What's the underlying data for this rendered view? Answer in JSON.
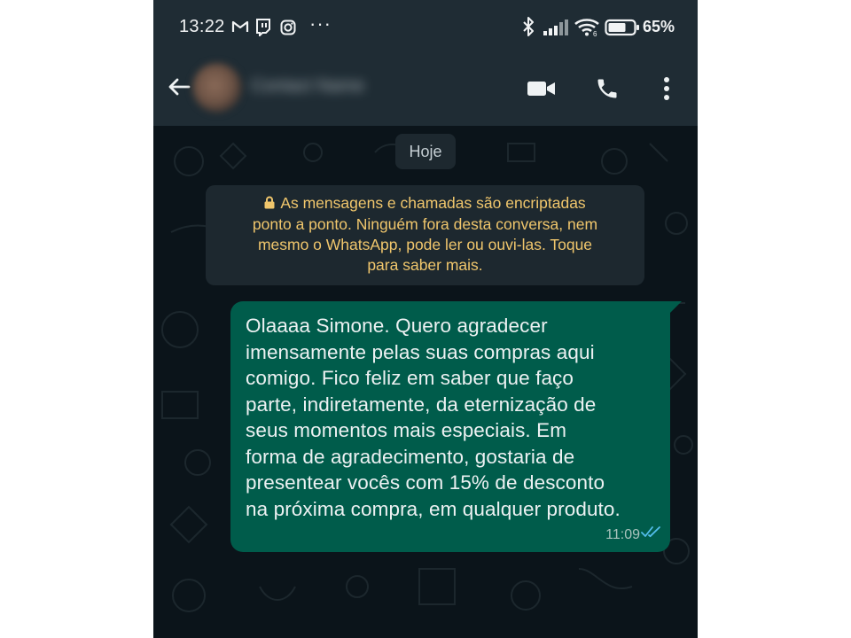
{
  "status_bar": {
    "time": "13:22",
    "overflow": "···",
    "battery": "65%",
    "icons": [
      "gmail-icon",
      "twitch-icon",
      "instagram-icon",
      "bluetooth-icon",
      "signal-icon",
      "wifi-icon",
      "battery-icon"
    ]
  },
  "header": {
    "contact_name": "Contact Name",
    "icons": [
      "back-arrow-icon",
      "video-call-icon",
      "voice-call-icon",
      "more-options-icon"
    ]
  },
  "chat": {
    "date_label": "Hoje",
    "encryption_notice": [
      "As mensagens e chamadas são encriptadas",
      "ponto a ponto. Ninguém fora desta conversa, nem",
      "mesmo o WhatsApp, pode ler ou ouvi-las. Toque",
      "para saber mais."
    ],
    "message": {
      "lines": [
        "Olaaaa Simone. Quero agradecer",
        "imensamente pelas suas compras aqui",
        "comigo. Fico feliz em saber que faço",
        "parte, indiretamente, da eternização de",
        "seus momentos mais especiais. Em",
        "forma de agradecimento, gostaria de",
        "presentear vocês com 15% de desconto",
        "na próxima compra, em qualquer produto."
      ],
      "time": "11:09",
      "status": "read"
    }
  },
  "colors": {
    "header_bg": "#1f2c34",
    "chat_bg": "#0b141a",
    "outgoing_bubble": "#005c4b",
    "notice_text": "#f0c66c",
    "read_tick": "#53bdeb"
  }
}
